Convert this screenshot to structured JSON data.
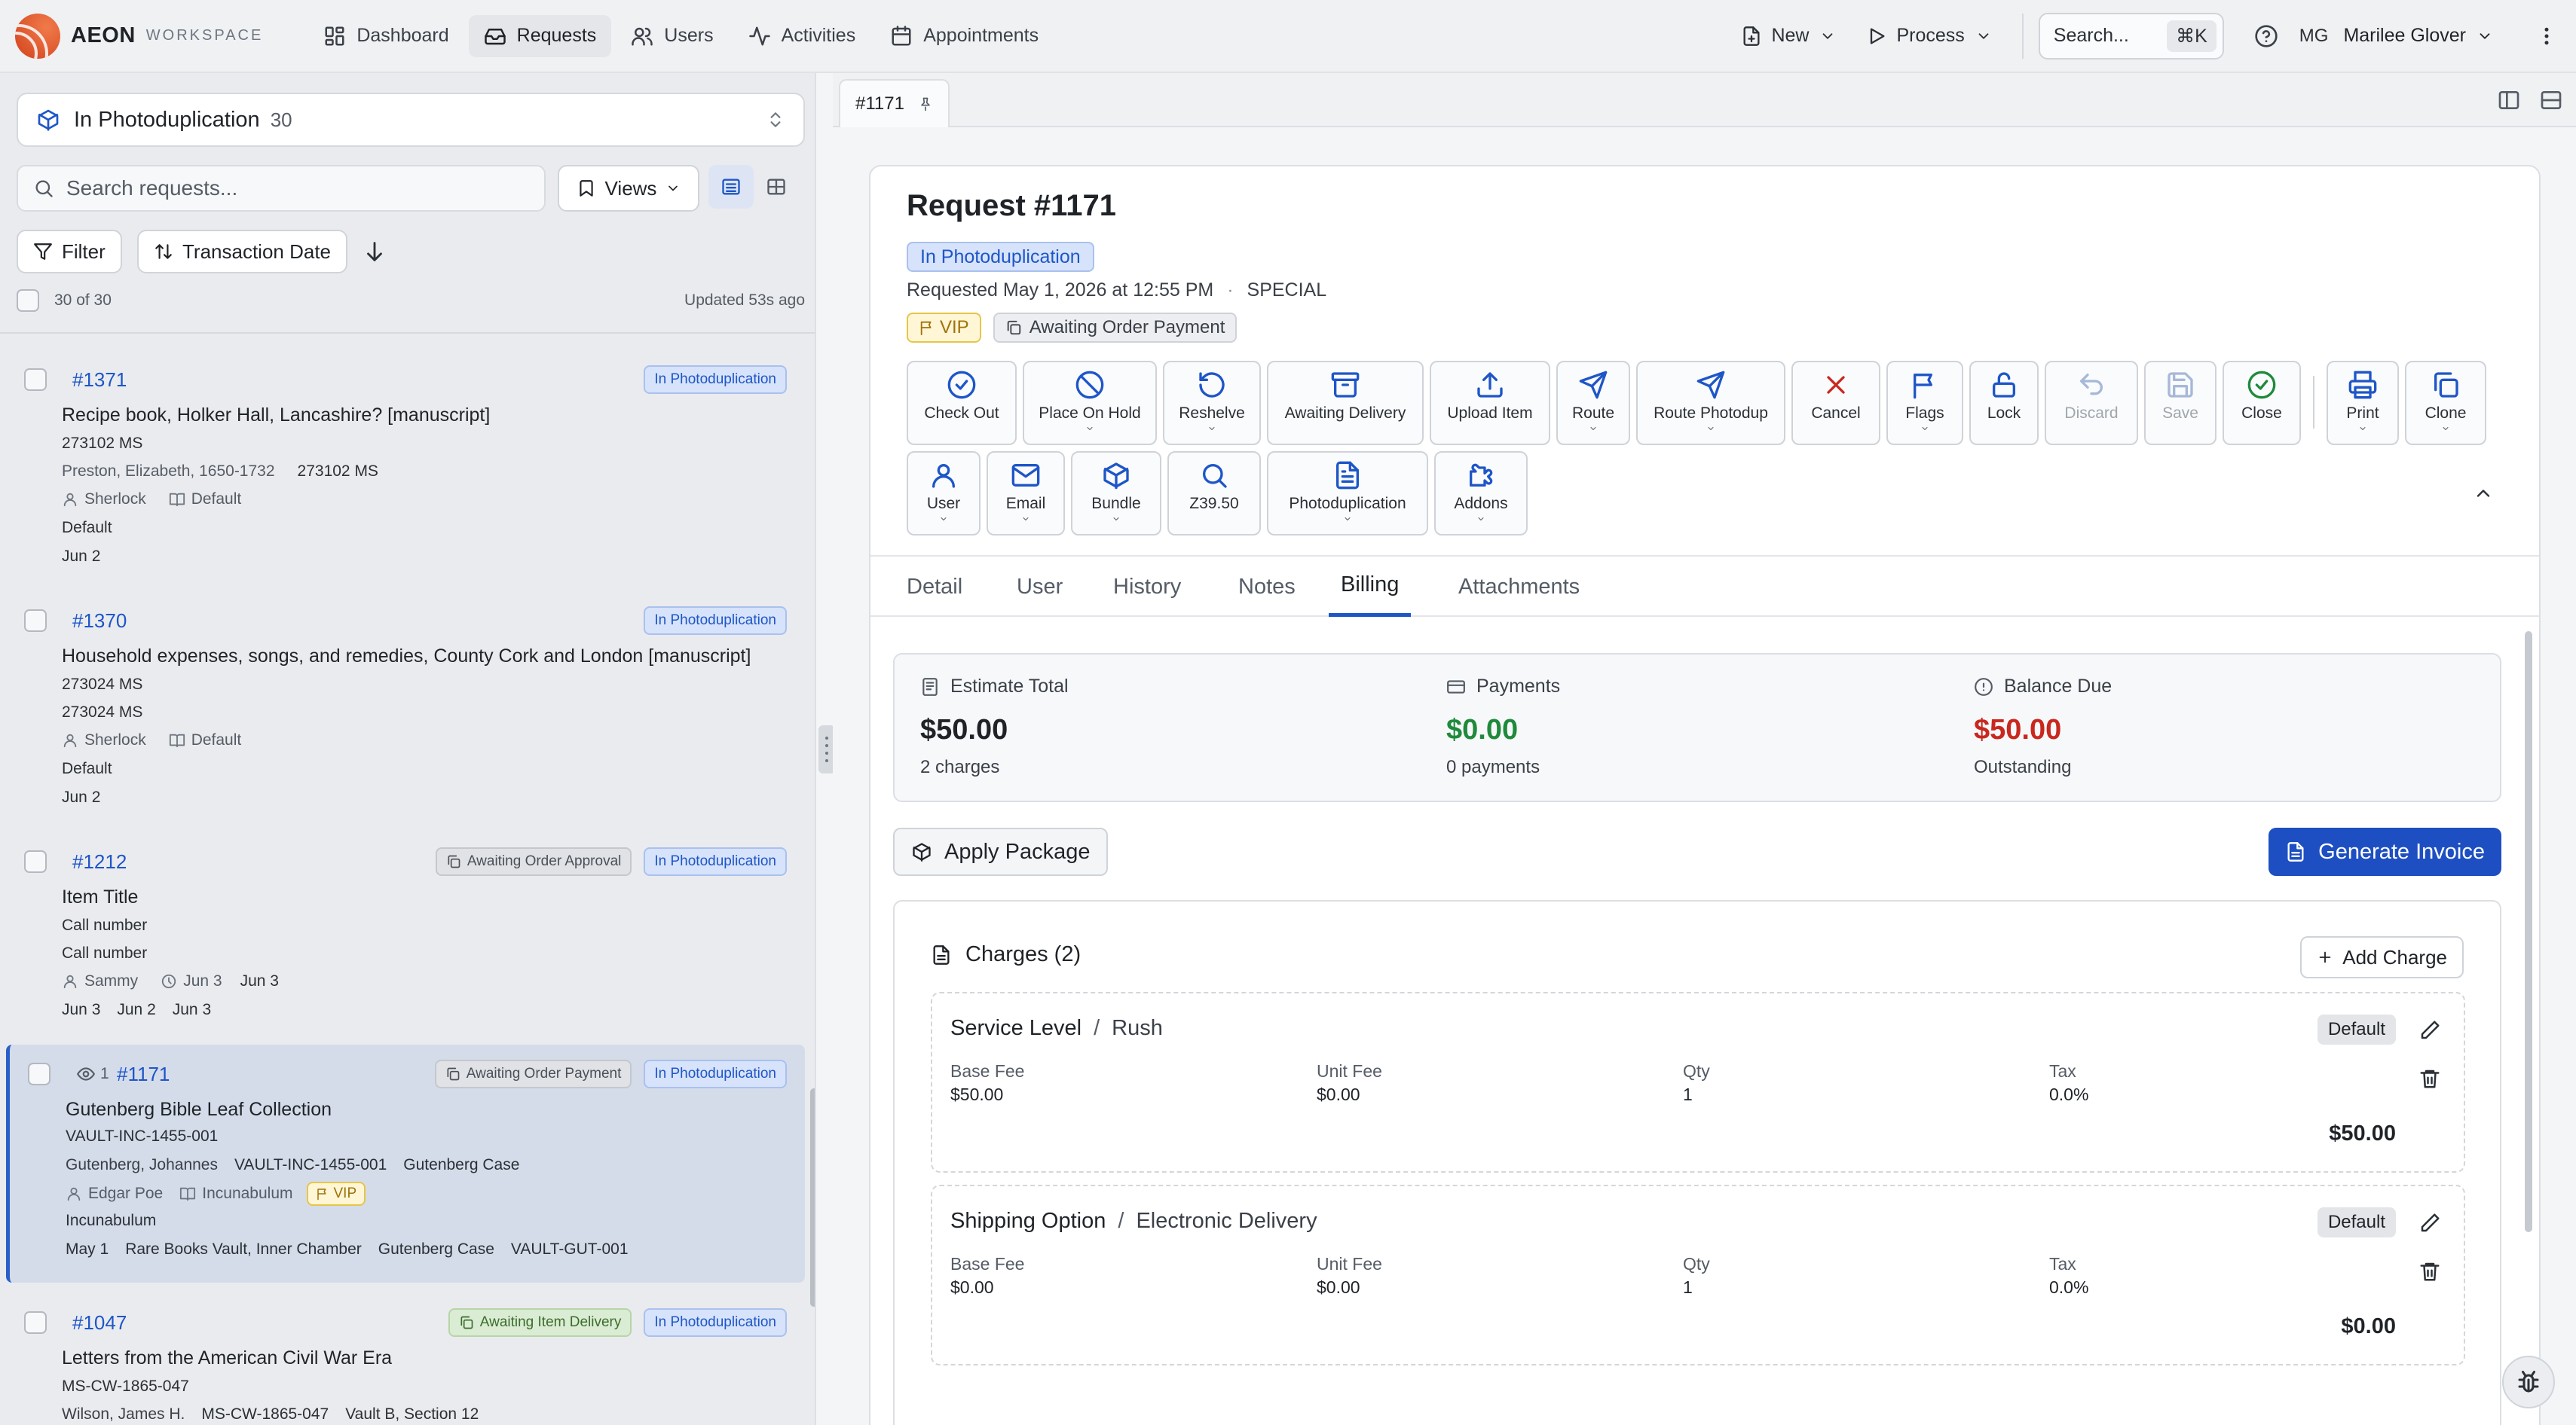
{
  "app": {
    "logo_name": "AEON",
    "logo_sub": "WORKSPACE"
  },
  "nav": [
    {
      "label": "Dashboard",
      "icon": "grid-icon",
      "active": false
    },
    {
      "label": "Requests",
      "icon": "inbox-icon",
      "active": true
    },
    {
      "label": "Users",
      "icon": "users-icon",
      "active": false
    },
    {
      "label": "Activities",
      "icon": "activity-icon",
      "active": false
    },
    {
      "label": "Appointments",
      "icon": "calendar-icon",
      "active": false
    }
  ],
  "topbar": {
    "new_label": "New",
    "process_label": "Process",
    "search_label": "Search...",
    "search_shortcut": "⌘K",
    "user_initials": "MG",
    "user_name": "Marilee Glover"
  },
  "list": {
    "status_filter": "In Photoduplication",
    "status_count": "30",
    "search_placeholder": "Search requests...",
    "views_label": "Views",
    "filter_label": "Filter",
    "sort_label": "Transaction Date",
    "selection": "30 of 30",
    "updated": "Updated 53s ago",
    "cards": [
      {
        "id": "#1371",
        "badges": [
          {
            "text": "In Photoduplication",
            "style": "blue"
          }
        ],
        "title": "Recipe book, Holker Hall, Lancashire? [manuscript]",
        "l1": "273102 MS",
        "l2a": "Preston, Elizabeth, 1650-1732",
        "l2b": "273102 MS",
        "user": "Sherlock",
        "format": "Default",
        "l4": "Default",
        "l5": "Jun 2"
      },
      {
        "id": "#1370",
        "badges": [
          {
            "text": "In Photoduplication",
            "style": "blue"
          }
        ],
        "title": "Household expenses, songs, and remedies, County Cork and London [manuscript]",
        "l1": "273024 MS",
        "l2": "273024 MS",
        "user": "Sherlock",
        "format": "Default",
        "l4": "Default",
        "l5": "Jun 2"
      },
      {
        "id": "#1212",
        "badges": [
          {
            "text": "Awaiting Order Approval",
            "style": "gray"
          },
          {
            "text": "In Photoduplication",
            "style": "blue"
          }
        ],
        "title": "Item Title",
        "l1": "Call number",
        "l2": "Call number",
        "user": "Sammy",
        "clock_date": "Jun 3",
        "date2": "Jun 3",
        "dates": [
          "Jun 3",
          "Jun 2",
          "Jun 3"
        ]
      },
      {
        "id": "#1171",
        "views": "1",
        "selected": true,
        "badges": [
          {
            "text": "Awaiting Order Payment",
            "style": "gray"
          },
          {
            "text": "In Photoduplication",
            "style": "blue"
          }
        ],
        "title": "Gutenberg Bible Leaf Collection",
        "l1": "VAULT-INC-1455-001",
        "l2a": "Gutenberg, Johannes",
        "l2b": "VAULT-INC-1455-001",
        "l2c": "Gutenberg Case",
        "user": "Edgar Poe",
        "format": "Incunabulum",
        "vip": "VIP",
        "l4": "Incunabulum",
        "l5": [
          "May 1",
          "Rare Books Vault, Inner Chamber",
          "Gutenberg Case",
          "VAULT-GUT-001"
        ]
      },
      {
        "id": "#1047",
        "badges": [
          {
            "text": "Awaiting Item Delivery",
            "style": "green"
          },
          {
            "text": "In Photoduplication",
            "style": "blue"
          }
        ],
        "title": "Letters from the American Civil War Era",
        "l1": "MS-CW-1865-047",
        "l2a": "Wilson, James H.",
        "l2b": "MS-CW-1865-047",
        "l2c": "Vault B, Section 12"
      }
    ]
  },
  "doc_tab": {
    "label": "#1171"
  },
  "request": {
    "title": "Request #1171",
    "status": "In Photoduplication",
    "requested": "Requested May 1, 2026 at 12:55 PM",
    "dot": "·",
    "type": "SPECIAL",
    "vip": "VIP",
    "flag": "Awaiting Order Payment"
  },
  "actions_row1": [
    {
      "label": "Check Out",
      "icon": "check-circle-icon",
      "dropdown": false,
      "style": "blue"
    },
    {
      "label": "Place On Hold",
      "icon": "ban-icon",
      "dropdown": true,
      "style": "blue"
    },
    {
      "label": "Reshelve",
      "icon": "rotate-icon",
      "dropdown": true,
      "style": "blue"
    },
    {
      "label": "Awaiting Delivery",
      "icon": "archive-icon",
      "dropdown": false,
      "style": "blue"
    },
    {
      "label": "Upload Item",
      "icon": "upload-icon",
      "dropdown": false,
      "style": "blue"
    },
    {
      "label": "Route",
      "icon": "send-icon",
      "dropdown": true,
      "style": "blue"
    },
    {
      "label": "Route Photodup",
      "icon": "send-icon",
      "dropdown": true,
      "style": "blue"
    },
    {
      "label": "Cancel",
      "icon": "x-icon",
      "dropdown": false,
      "style": "red"
    },
    {
      "label": "Flags",
      "icon": "flag-icon",
      "dropdown": true,
      "style": "blue"
    },
    {
      "label": "Lock",
      "icon": "lock-icon",
      "dropdown": false,
      "style": "blue"
    },
    {
      "label": "Discard",
      "icon": "undo-icon",
      "dropdown": false,
      "style": "disabled"
    },
    {
      "label": "Save",
      "icon": "save-icon",
      "dropdown": false,
      "style": "disabled"
    },
    {
      "label": "Close",
      "icon": "check-circle-icon",
      "dropdown": false,
      "style": "green"
    },
    {
      "label": "Print",
      "icon": "printer-icon",
      "dropdown": true,
      "style": "blue"
    },
    {
      "label": "Clone",
      "icon": "copy-icon",
      "dropdown": true,
      "style": "blue"
    }
  ],
  "actions_row2": [
    {
      "label": "User",
      "icon": "user-icon",
      "dropdown": true
    },
    {
      "label": "Email",
      "icon": "mail-icon",
      "dropdown": true
    },
    {
      "label": "Bundle",
      "icon": "package-icon",
      "dropdown": true
    },
    {
      "label": "Z39.50",
      "icon": "search-icon",
      "dropdown": false
    },
    {
      "label": "Photoduplication",
      "icon": "file-text-icon",
      "dropdown": true
    },
    {
      "label": "Addons",
      "icon": "puzzle-icon",
      "dropdown": true
    }
  ],
  "tabs": [
    "Detail",
    "User",
    "History",
    "Notes",
    "Billing",
    "Attachments"
  ],
  "active_tab": "Billing",
  "billing": {
    "estimate_label": "Estimate Total",
    "estimate_value": "$50.00",
    "estimate_sub": "2 charges",
    "payments_label": "Payments",
    "payments_value": "$0.00",
    "payments_sub": "0 payments",
    "balance_label": "Balance Due",
    "balance_value": "$50.00",
    "balance_sub": "Outstanding",
    "apply_label": "Apply Package",
    "generate_label": "Generate Invoice",
    "charges_title": "Charges (2)",
    "add_charge_label": "Add Charge",
    "charges": [
      {
        "name": "Service Level",
        "sep": "/",
        "option": "Rush",
        "badge": "Default",
        "base_fee_label": "Base Fee",
        "base_fee": "$50.00",
        "unit_fee_label": "Unit Fee",
        "unit_fee": "$0.00",
        "qty_label": "Qty",
        "qty": "1",
        "tax_label": "Tax",
        "tax": "0.0%",
        "total": "$50.00"
      },
      {
        "name": "Shipping Option",
        "sep": "/",
        "option": "Electronic Delivery",
        "badge": "Default",
        "base_fee_label": "Base Fee",
        "base_fee": "$0.00",
        "unit_fee_label": "Unit Fee",
        "unit_fee": "$0.00",
        "qty_label": "Qty",
        "qty": "1",
        "tax_label": "Tax",
        "tax": "0.0%",
        "total": "$0.00"
      }
    ]
  },
  "colors": {
    "accent": "#1e56c8",
    "primary_button": "#1e4fc2",
    "success": "#1f8a3c",
    "danger": "#c8281e",
    "vip": "#e6c64a"
  }
}
